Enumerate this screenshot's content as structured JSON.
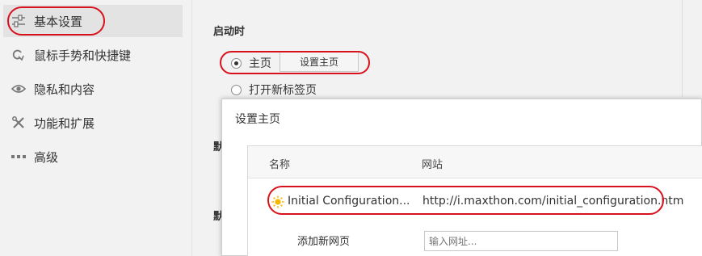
{
  "sidebar": {
    "items": [
      {
        "label": "基本设置",
        "icon": "sliders-icon",
        "active": true
      },
      {
        "label": "鼠标手势和快捷键",
        "icon": "gesture-icon",
        "active": false
      },
      {
        "label": "隐私和内容",
        "icon": "eye-icon",
        "active": false
      },
      {
        "label": "功能和扩展",
        "icon": "wrench-icon",
        "active": false
      },
      {
        "label": "高级",
        "icon": "more-icon",
        "active": false
      }
    ]
  },
  "startup": {
    "title": "启动时",
    "option_home": "主页",
    "set_home_button": "设置主页",
    "option_new_tab": "打开新标签页",
    "selected": "主页"
  },
  "hidden_labels": [
    "默",
    "默"
  ],
  "dialog": {
    "title": "设置主页",
    "columns": [
      "名称",
      "网站"
    ],
    "rows": [
      {
        "name": "Initial Configuration...",
        "url": "http://i.maxthon.com/initial_configuration.htm"
      }
    ],
    "add_label": "添加新网页",
    "url_placeholder": "输入网址..."
  },
  "annotation_color": "#d8121d"
}
